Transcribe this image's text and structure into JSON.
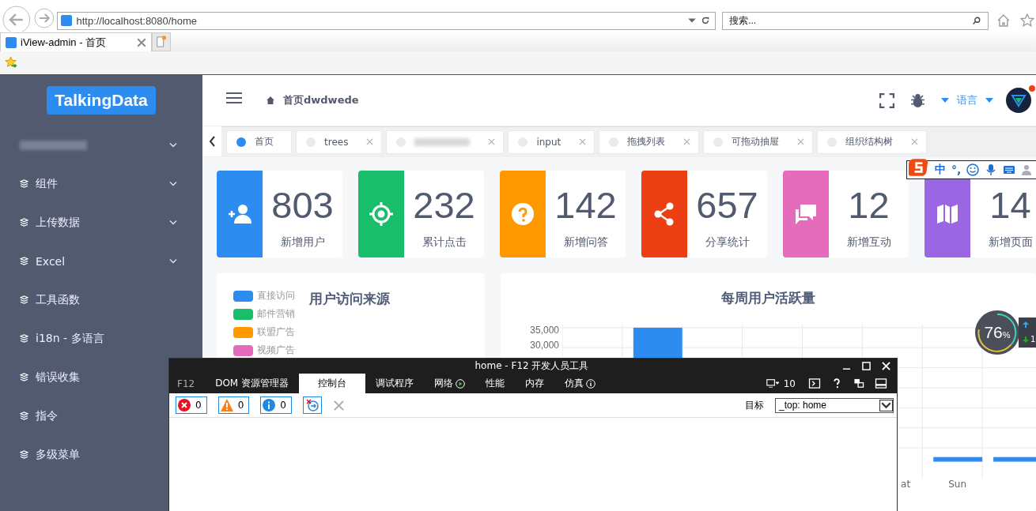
{
  "browser": {
    "url": "http://localhost:8080/home",
    "search_placeholder": "搜索...",
    "tab_title": "iView-admin - 首页"
  },
  "sidebar": {
    "logo": "TalkingData",
    "items": [
      {
        "kind": "blurred",
        "expandable": true
      },
      {
        "label": "组件",
        "kind": "item",
        "expandable": true
      },
      {
        "label": "上传数据",
        "kind": "item",
        "expandable": true
      },
      {
        "label": "Excel",
        "kind": "item",
        "expandable": true
      },
      {
        "label": "工具函数",
        "kind": "item",
        "expandable": false
      },
      {
        "label": "i18n - 多语言",
        "kind": "item",
        "expandable": false
      },
      {
        "label": "错误收集",
        "kind": "item"
      },
      {
        "label": "指令",
        "kind": "item"
      },
      {
        "label": "多级菜单",
        "kind": "item"
      }
    ]
  },
  "header": {
    "breadcrumb": "首页dwdwede",
    "language": "语言",
    "has_notification": true
  },
  "tabs": [
    {
      "label": "首页",
      "selected": true,
      "kind": "tab"
    },
    {
      "label": "trees",
      "selected": false,
      "kind": "tab"
    },
    {
      "selected": false,
      "kind": "blurred"
    },
    {
      "label": "input",
      "selected": false,
      "kind": "tab"
    },
    {
      "label": "拖拽列表",
      "selected": false,
      "kind": "tab"
    },
    {
      "label": "可拖动抽屉",
      "selected": false,
      "kind": "tab"
    },
    {
      "label": "组织结构树",
      "selected": false,
      "kind": "tab"
    }
  ],
  "stats": [
    {
      "count": "803",
      "label": "新增用户",
      "color": "#2d8cf0"
    },
    {
      "count": "232",
      "label": "累计点击",
      "color": "#19be6b"
    },
    {
      "count": "142",
      "label": "新增问答",
      "color": "#ff9900"
    },
    {
      "count": "657",
      "label": "分享统计",
      "color": "#ed3f14"
    },
    {
      "count": "12",
      "label": "新增互动",
      "color": "#e46cbb"
    },
    {
      "count": "14",
      "label": "新增页面",
      "color": "#9a66e4"
    }
  ],
  "pie_panel": {
    "title": "用户访问来源",
    "legend": [
      {
        "label": "直接访问",
        "color": "#2d8cf0"
      },
      {
        "label": "邮件营销",
        "color": "#19be6b"
      },
      {
        "label": "联盟广告",
        "color": "#ff9900"
      },
      {
        "label": "视频广告",
        "color": "#e46cbb"
      }
    ]
  },
  "bar_panel": {
    "title": "每周用户活跃量",
    "y_tick_labels": [
      "35,000",
      "30,000"
    ],
    "x_labels": [
      "at",
      "Sun"
    ]
  },
  "ime_toolbar": {
    "mode": "中",
    "punctuation": "°,"
  },
  "memory_widget": {
    "percent": "76",
    "unit": "%",
    "extra": "1"
  },
  "devtools": {
    "title": "home - F12 开发人员工具",
    "tabs": [
      {
        "label": "F12",
        "selected": false,
        "kind": "plain"
      },
      {
        "label": "DOM 资源管理器",
        "selected": false,
        "kind": "plain"
      },
      {
        "label": "控制台",
        "selected": true,
        "kind": "plain"
      },
      {
        "label": "调试程序",
        "selected": false,
        "kind": "plain"
      },
      {
        "label": "网络",
        "selected": false,
        "kind": "play"
      },
      {
        "label": "性能",
        "selected": false,
        "kind": "plain"
      },
      {
        "label": "内存",
        "selected": false,
        "kind": "plain"
      },
      {
        "label": "仿真",
        "selected": false,
        "kind": "info"
      }
    ],
    "screen_count": "10",
    "counters": [
      {
        "kind": "error",
        "value": "0"
      },
      {
        "kind": "warning",
        "value": "0"
      },
      {
        "kind": "info",
        "value": "0"
      }
    ],
    "target_label": "目标",
    "target_value": "_top: home"
  }
}
